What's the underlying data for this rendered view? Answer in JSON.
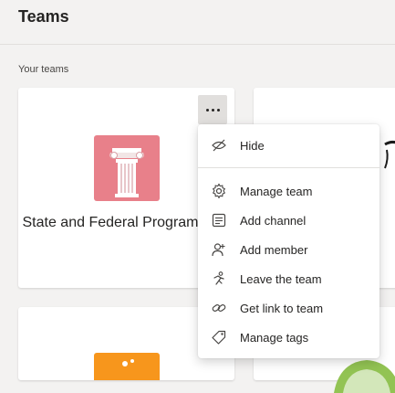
{
  "header": {
    "title": "Teams"
  },
  "section": {
    "label": "Your teams"
  },
  "team_card": {
    "name": "State and Federal Programs",
    "logo_icon": "column-pillar-icon",
    "logo_color": "#e8808a"
  },
  "right_card": {
    "partial_title": "t F"
  },
  "more_button": {
    "icon": "more-options-icon"
  },
  "menu": {
    "items": [
      {
        "label": "Hide",
        "icon": "hide-eye-icon"
      },
      {
        "label": "Manage team",
        "icon": "gear-icon"
      },
      {
        "label": "Add channel",
        "icon": "add-channel-icon"
      },
      {
        "label": "Add member",
        "icon": "add-member-icon"
      },
      {
        "label": "Leave the team",
        "icon": "leave-team-icon"
      },
      {
        "label": "Get link to team",
        "icon": "link-icon"
      },
      {
        "label": "Manage tags",
        "icon": "tag-icon"
      }
    ]
  },
  "colors": {
    "background": "#f3f2f1",
    "card": "#ffffff",
    "text": "#252423",
    "orange_logo": "#f7961c",
    "green_logo": "#92c353"
  }
}
